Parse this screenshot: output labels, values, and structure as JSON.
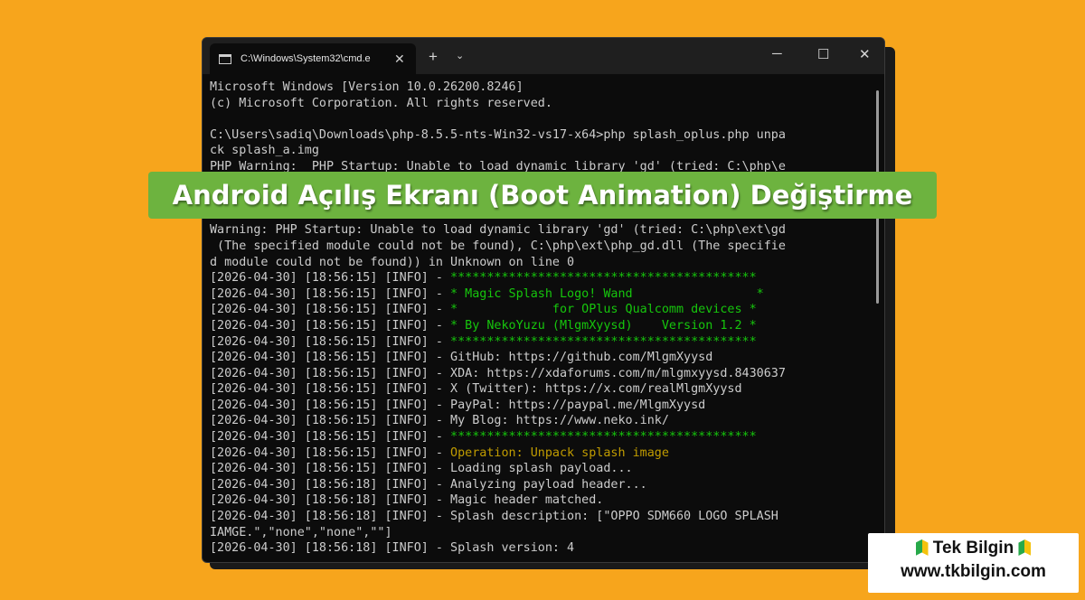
{
  "window": {
    "tab_title": "C:\\Windows\\System32\\cmd.e",
    "tab_close": "✕",
    "new_tab": "+",
    "dropdown": "⌄",
    "minimize": "─",
    "maximize": "☐",
    "close": "✕"
  },
  "terminal": {
    "lines": [
      {
        "text": "Microsoft Windows [Version 10.0.26200.8246]"
      },
      {
        "text": "(c) Microsoft Corporation. All rights reserved."
      },
      {
        "text": ""
      },
      {
        "text": "C:\\Users\\sadiq\\Downloads\\php-8.5.5-nts-Win32-vs17-x64>php splash_oplus.php unpa"
      },
      {
        "text": "ck splash_a.img"
      },
      {
        "text": "PHP Warning:  PHP Startup: Unable to load dynamic library 'gd' (tried: C:\\php\\e"
      },
      {
        "text": ""
      },
      {
        "text": ""
      },
      {
        "text": "",
        "note": ""
      },
      {
        "text": "Warning: PHP Startup: Unable to load dynamic library 'gd' (tried: C:\\php\\ext\\gd"
      },
      {
        "text": " (The specified module could not be found), C:\\php\\ext\\php_gd.dll (The specifie"
      },
      {
        "text": "d module could not be found)) in Unknown on line 0"
      },
      {
        "prefix": "[2026-04-30] [18:56:15] [INFO] - ",
        "text": "******************************************",
        "color": "green"
      },
      {
        "prefix": "[2026-04-30] [18:56:15] [INFO] - ",
        "text": "* Magic Splash Logo! Wand                 *",
        "color": "green"
      },
      {
        "prefix": "[2026-04-30] [18:56:15] [INFO] - ",
        "text": "*             for OPlus Qualcomm devices *",
        "color": "green"
      },
      {
        "prefix": "[2026-04-30] [18:56:15] [INFO] - ",
        "text": "* By NekoYuzu (MlgmXyysd)    Version 1.2 *",
        "color": "green"
      },
      {
        "prefix": "[2026-04-30] [18:56:15] [INFO] - ",
        "text": "******************************************",
        "color": "green"
      },
      {
        "prefix": "[2026-04-30] [18:56:15] [INFO] - ",
        "text": "GitHub: https://github.com/MlgmXyysd"
      },
      {
        "prefix": "[2026-04-30] [18:56:15] [INFO] - ",
        "text": "XDA: https://xdaforums.com/m/mlgmxyysd.8430637"
      },
      {
        "prefix": "[2026-04-30] [18:56:15] [INFO] - ",
        "text": "X (Twitter): https://x.com/realMlgmXyysd"
      },
      {
        "prefix": "[2026-04-30] [18:56:15] [INFO] - ",
        "text": "PayPal: https://paypal.me/MlgmXyysd"
      },
      {
        "prefix": "[2026-04-30] [18:56:15] [INFO] - ",
        "text": "My Blog: https://www.neko.ink/"
      },
      {
        "prefix": "[2026-04-30] [18:56:15] [INFO] - ",
        "text": "******************************************",
        "color": "green"
      },
      {
        "prefix": "[2026-04-30] [18:56:15] [INFO] - ",
        "text": "Operation: Unpack splash image",
        "color": "yellow"
      },
      {
        "prefix": "[2026-04-30] [18:56:15] [INFO] - ",
        "text": "Loading splash payload..."
      },
      {
        "prefix": "[2026-04-30] [18:56:18] [INFO] - ",
        "text": "Analyzing payload header..."
      },
      {
        "prefix": "[2026-04-30] [18:56:18] [INFO] - ",
        "text": "Magic header matched."
      },
      {
        "prefix": "[2026-04-30] [18:56:18] [INFO] - ",
        "text": "Splash description: [\"OPPO SDM660 LOGO SPLASH"
      },
      {
        "text": "IAMGE.\",\"none\",\"none\",\"\"]"
      },
      {
        "prefix": "[2026-04-30] [18:56:18] [INFO] - ",
        "text": "Splash version: 4"
      }
    ]
  },
  "banner": {
    "title": "Android Açılış Ekranı (Boot Animation) Değiştirme"
  },
  "badge": {
    "title": "Tek Bilgin",
    "url": "www.tkbilgin.com"
  },
  "colors": {
    "background": "#f7a51c",
    "terminal_bg": "#0c0c0c",
    "banner_bg": "#6db33f",
    "green": "#16c60c",
    "yellow": "#c19c00"
  }
}
